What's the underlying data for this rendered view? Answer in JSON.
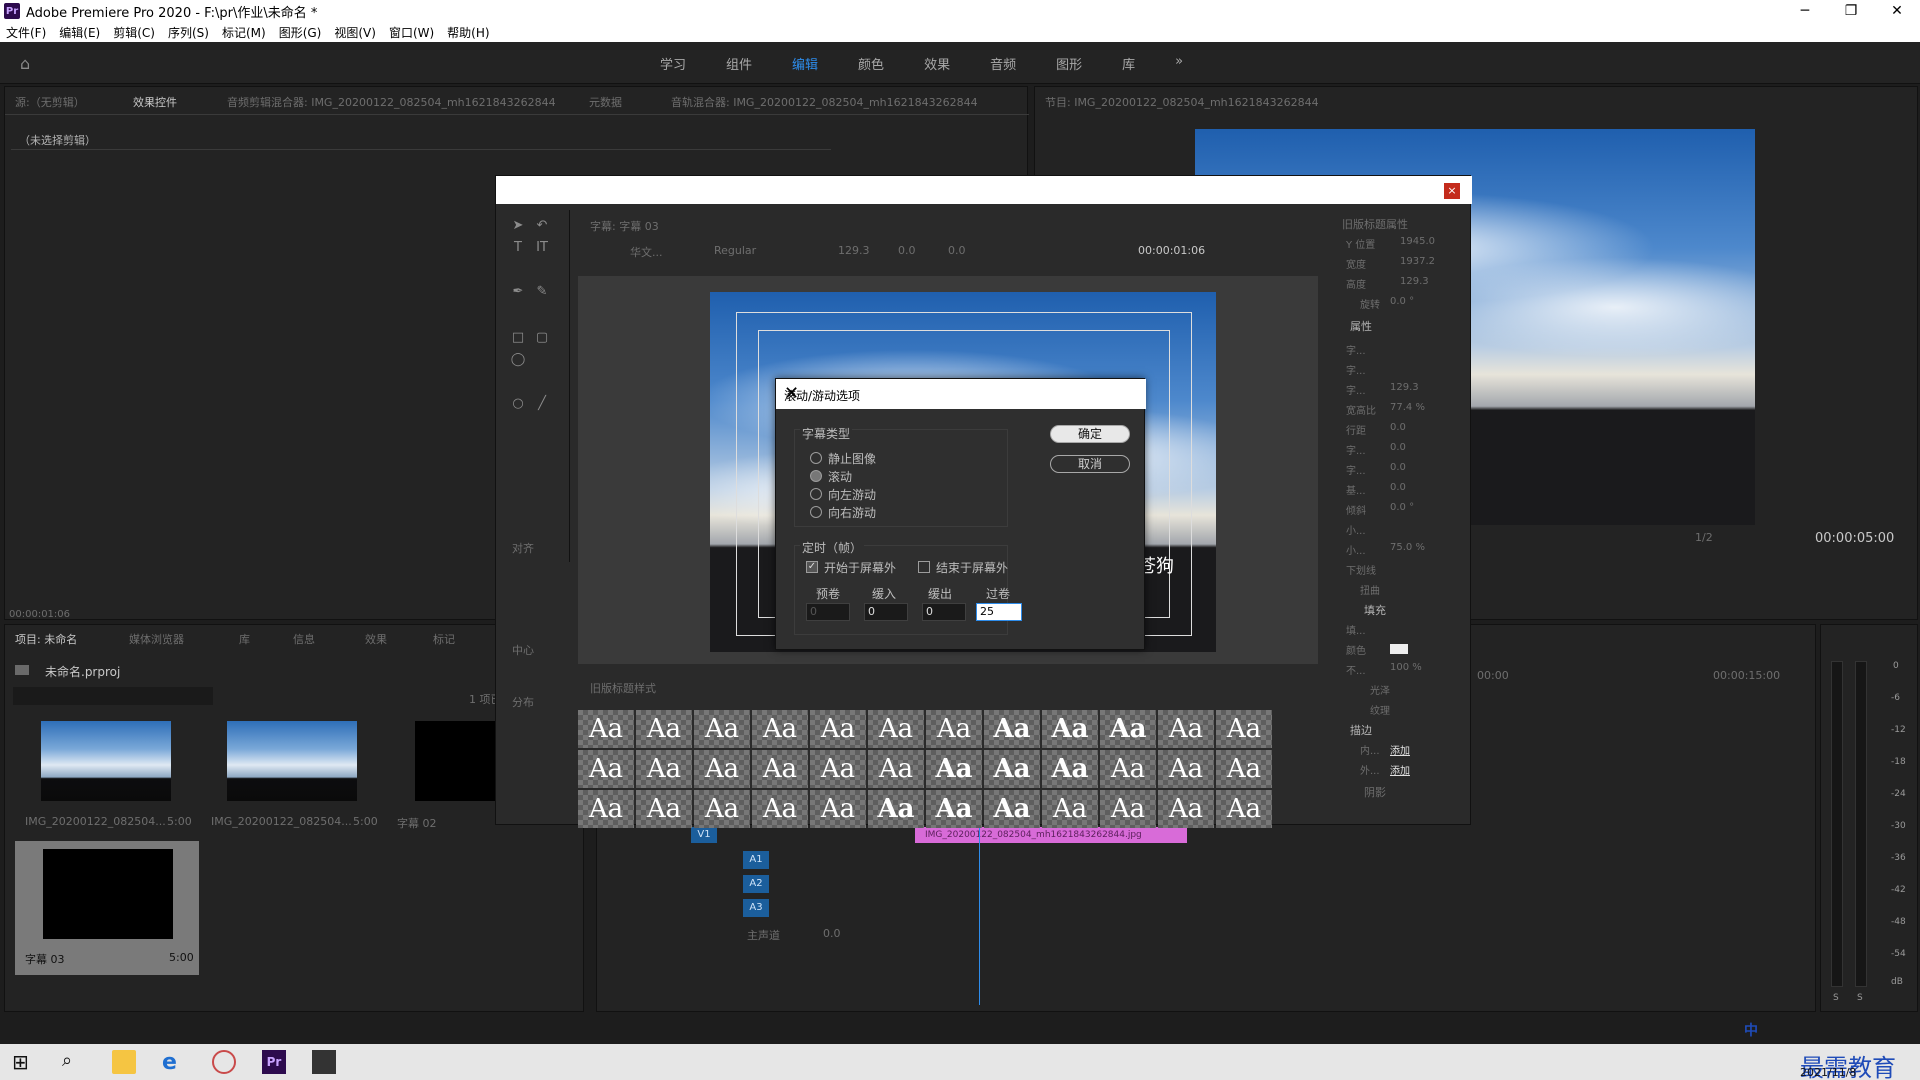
{
  "window": {
    "title": "Adobe Premiere Pro 2020 - F:\\pr\\作业\\未命名 *",
    "logo": "Pr",
    "controls": [
      "─",
      "❐",
      "✕"
    ]
  },
  "menu": [
    "文件(F)",
    "编辑(E)",
    "剪辑(C)",
    "序列(S)",
    "标记(M)",
    "图形(G)",
    "视图(V)",
    "窗口(W)",
    "帮助(H)"
  ],
  "workspaces": {
    "tabs": [
      "学习",
      "组件",
      "编辑",
      "颜色",
      "效果",
      "音频",
      "图形",
      "库"
    ],
    "active": "编辑",
    "more": "»"
  },
  "source_panel": {
    "tabs": [
      "源:（无剪辑）",
      "效果控件",
      "音频剪辑混合器: IMG_20200122_082504_mh1621843262844",
      "元数据",
      "音轨混合器: IMG_20200122_082504_mh1621843262844"
    ],
    "no_clip": "（未选择剪辑）",
    "timecode": "00:00:01:06"
  },
  "program_panel": {
    "tab": "节目: IMG_20200122_082504_mh1621843262844",
    "timecode": "00:00:05:00",
    "zoom": "1/2"
  },
  "project_panel": {
    "tabs": [
      "项目: 未命名",
      "媒体浏览器",
      "库",
      "信息",
      "效果",
      "标记"
    ],
    "project_file": "未命名.prproj",
    "item_count": "1 项已",
    "items": [
      {
        "name": "IMG_20200122_082504...",
        "duration": "5:00"
      },
      {
        "name": "IMG_20200122_082504...",
        "duration": "5:00"
      },
      {
        "name": "字幕 02",
        "duration": ""
      },
      {
        "name": "字幕 03",
        "duration": "5:00"
      }
    ]
  },
  "titler": {
    "tab": "字幕: 字幕 03",
    "font": "华文...",
    "style": "Regular",
    "size": "129.3",
    "kerning": "0.0",
    "leading": "0.0",
    "timecode": "00:00:01:06",
    "align_header": "对齐",
    "center_header": "中心",
    "distribute_header": "分布",
    "styles_tab": "旧版标题样式",
    "style_sample": "Aa",
    "caption_text": "苍狗",
    "properties": {
      "header": "旧版标题属性",
      "rows": [
        {
          "label": "Y 位置",
          "value": "1945.0"
        },
        {
          "label": "宽度",
          "value": "1937.2"
        },
        {
          "label": "高度",
          "value": "129.3"
        },
        {
          "label": "旋转",
          "value": "0.0 °"
        }
      ],
      "attr_header": "属性",
      "attr_rows": [
        {
          "label": "字...",
          "value": ""
        },
        {
          "label": "字...",
          "value": ""
        },
        {
          "label": "字...",
          "value": "129.3"
        },
        {
          "label": "宽高比",
          "value": "77.4 %"
        },
        {
          "label": "行距",
          "value": "0.0"
        },
        {
          "label": "字...",
          "value": "0.0"
        },
        {
          "label": "字...",
          "value": "0.0"
        },
        {
          "label": "基...",
          "value": "0.0"
        },
        {
          "label": "倾斜",
          "value": "0.0 °"
        },
        {
          "label": "小...",
          "value": ""
        },
        {
          "label": "小...",
          "value": "75.0 %"
        },
        {
          "label": "下划线",
          "value": ""
        },
        {
          "label": "扭曲",
          "value": ""
        }
      ],
      "fill_header": "填充",
      "fill_rows": [
        {
          "label": "填...",
          "value": ""
        },
        {
          "label": "颜色",
          "value": ""
        },
        {
          "label": "不...",
          "value": "100 %"
        },
        {
          "label": "光泽",
          "value": ""
        },
        {
          "label": "纹理",
          "value": ""
        }
      ],
      "stroke_header": "描边",
      "stroke_rows": [
        {
          "label": "内...",
          "value": "添加"
        },
        {
          "label": "外...",
          "value": "添加"
        }
      ],
      "shadow_header": "阴影"
    }
  },
  "scroll_dialog": {
    "title": "滚动/游动选项",
    "type_label": "字幕类型",
    "types": [
      {
        "label": "静止图像",
        "selected": false
      },
      {
        "label": "滚动",
        "selected": true
      },
      {
        "label": "向左游动",
        "selected": false
      },
      {
        "label": "向右游动",
        "selected": false
      }
    ],
    "timing_label": "定时（帧）",
    "start_off": {
      "label": "开始于屏幕外",
      "checked": true
    },
    "end_off": {
      "label": "结束于屏幕外",
      "checked": false
    },
    "fields": [
      {
        "label": "预卷",
        "value": "0"
      },
      {
        "label": "缓入",
        "value": "0"
      },
      {
        "label": "缓出",
        "value": "0"
      },
      {
        "label": "过卷",
        "value": "25"
      }
    ],
    "ok": "确定",
    "cancel": "取消"
  },
  "timeline": {
    "ruler": [
      "00:00",
      "00:00:15:00"
    ],
    "tracks": [
      "V1",
      "A1",
      "A2",
      "A3"
    ],
    "master_label": "主声道",
    "master_value": "0.0",
    "clip": "IMG_20200122_082504_mh1621843262844.jpg"
  },
  "meters": {
    "scale": [
      "0",
      "-6",
      "-12",
      "-18",
      "-24",
      "-30",
      "-36",
      "-42",
      "-48",
      "-54",
      "dB"
    ],
    "buttons": [
      "S",
      "S"
    ]
  },
  "taskbar": {
    "ime": "中",
    "time": "2021/11/8",
    "watermark": "最需教育"
  },
  "colors": {
    "accent": "#2d8ceb",
    "clip": "#d86bd8",
    "panel_bg": "#232323"
  }
}
